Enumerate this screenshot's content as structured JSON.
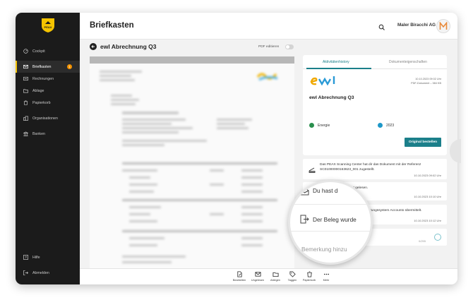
{
  "sidebar": {
    "items": [
      {
        "label": "Cockpit",
        "icon": "gauge-icon"
      },
      {
        "label": "Briefkasten",
        "icon": "mail-icon",
        "badge": "1",
        "active": true
      },
      {
        "label": "Rechnungen",
        "icon": "invoice-icon"
      },
      {
        "label": "Ablage",
        "icon": "folder-icon"
      },
      {
        "label": "Papierkorb",
        "icon": "trash-icon"
      },
      {
        "label": "Organisationen",
        "icon": "organization-icon"
      },
      {
        "label": "Banken",
        "icon": "bank-icon"
      }
    ],
    "bottom": [
      {
        "label": "Hilfe",
        "icon": "help-icon"
      },
      {
        "label": "Abmelden",
        "icon": "logout-icon"
      }
    ],
    "logo_text": "PEAX"
  },
  "header": {
    "title": "Briefkasten",
    "company": "Maler Biracchi AG",
    "avatar_letter": "M"
  },
  "document": {
    "title": "ewl Abrechnung Q3",
    "pdf_edit_label": "PDF editieren"
  },
  "details": {
    "tabs": [
      "Aktivitätenhistory",
      "Dokumenteigenschaften"
    ],
    "sender_logo": "ewl",
    "date": "10.10.2023 09:02 Uhr",
    "file_info": "PDF-Dokument – 384 KB",
    "doc_name": "ewl Abrechnung Q3",
    "tags": [
      {
        "label": "Energie",
        "color": "#2a8f4d"
      },
      {
        "label": "2023",
        "color": "#1e98c8"
      }
    ],
    "order_button": "Original bestellen"
  },
  "activities": [
    {
      "text": "Das PEAX Scanning Center hat dir das Dokument mit der Referenz SC01000000163623_001 zugestellt.",
      "time": "10.10.2023 09:02 Uhr"
    },
    {
      "text": "Du hast das Dokument gelesen.",
      "time": "10.10.2023 10:10 Uhr"
    },
    {
      "text": "Der Beleg wurde an dein Buchhaltungssystem Accounto übermittelt.",
      "time": "10.10.2023 10:12 Uhr"
    }
  ],
  "remark": {
    "placeholder": "Bemerkung hinzufügen",
    "counter": "0/255"
  },
  "lens": {
    "row1": "Du hast d",
    "row2": "Der Beleg wurde",
    "row3": "Bemerkung hinzu"
  },
  "toolbar": [
    "Bearbeiten",
    "Ungelesen",
    "Ablegen",
    "Taggen",
    "Papierkorb",
    "Mehr"
  ]
}
